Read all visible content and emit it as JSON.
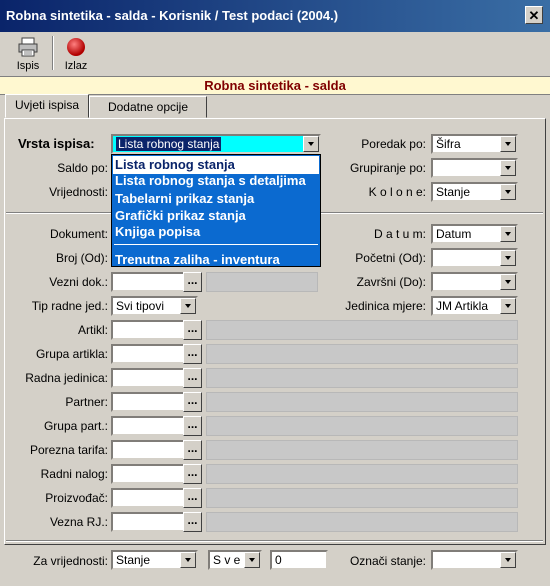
{
  "window": {
    "title": "Robna sintetika - salda - Korisnik / Test podaci (2004.)",
    "close_glyph": "✕"
  },
  "toolbar": {
    "print_label": "Ispis",
    "exit_label": "Izlaz"
  },
  "header": "Robna sintetika - salda",
  "tabs": [
    "Uvjeti ispisa",
    "Dodatne opcije"
  ],
  "left": {
    "vrsta_ispisa": {
      "label": "Vrsta ispisa:",
      "value": "Lista robnog stanja"
    },
    "saldo_po": {
      "label": "Saldo po:"
    },
    "vrijednosti": {
      "label": "Vrijednosti:"
    }
  },
  "right": {
    "poredak": {
      "label": "Poredak po:",
      "value": "Šifra"
    },
    "grupiranje": {
      "label": "Grupiranje po:",
      "value": ""
    },
    "kolone": {
      "label": "K o l o n e:",
      "value": "Stanje"
    }
  },
  "dropdown_items": [
    "Lista robnog stanja",
    "Lista robnog stanja s detaljima",
    "Tabelarni prikaz stanja",
    "Grafički prikaz stanja",
    "Knjiga popisa",
    "Trenutna zaliha - inventura"
  ],
  "fields": {
    "dokument": "Dokument:",
    "broj": "Broj (Od):",
    "vezni": "Vezni dok.:",
    "tip": {
      "label": "Tip radne jed.:",
      "value": "Svi tipovi"
    },
    "datum": {
      "label": "D a t u m:",
      "value": "Datum"
    },
    "pocetni": "Početni (Od):",
    "zavrsni": "Završni (Do):",
    "jedinica": {
      "label": "Jedinica mjere:",
      "value": "JM Artikla"
    }
  },
  "filters": [
    "Artikl:",
    "Grupa artikla:",
    "Radna jedinica:",
    "Partner:",
    "Grupa part.:",
    "Porezna tarifa:",
    "Radni nalog:",
    "Proizvođač:",
    "Vezna RJ.:"
  ],
  "bottom": {
    "za_vrijednosti": {
      "label": "Za vrijednosti:",
      "value": "Stanje"
    },
    "sve": "S v e",
    "number": "0",
    "oznaci": {
      "label": "Označi stanje:",
      "value": ""
    }
  },
  "ellipsis": "..."
}
